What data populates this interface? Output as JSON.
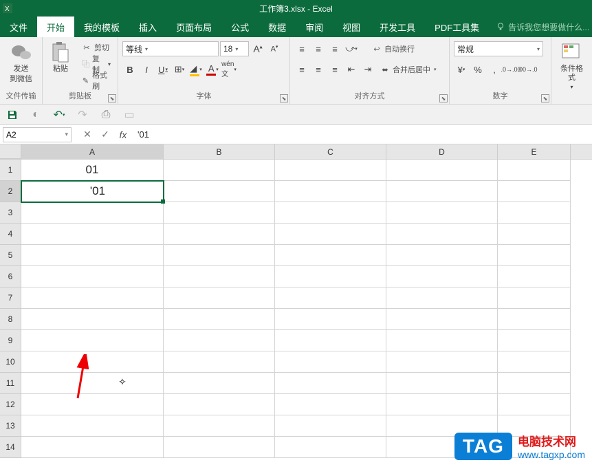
{
  "title": "工作簿3.xlsx - Excel",
  "menu": {
    "file": "文件",
    "home": "开始",
    "templates": "我的模板",
    "insert": "插入",
    "layout": "页面布局",
    "formulas": "公式",
    "data": "数据",
    "review": "审阅",
    "view": "视图",
    "dev": "开发工具",
    "pdf": "PDF工具集",
    "tellme": "告诉我您想要做什么..."
  },
  "ribbon": {
    "wechat": {
      "send": "发送",
      "to": "到微信",
      "group": "文件传输"
    },
    "clipboard": {
      "paste": "粘贴",
      "cut": "剪切",
      "copy": "复制",
      "format_painter": "格式刷",
      "group": "剪贴板"
    },
    "font": {
      "name": "等线",
      "size": "18",
      "bold": "B",
      "italic": "I",
      "underline": "U",
      "group": "字体"
    },
    "align": {
      "wrap": "自动换行",
      "merge": "合并后居中",
      "group": "对齐方式"
    },
    "number": {
      "format": "常规",
      "group": "数字"
    },
    "styles": {
      "cond": "条件格式",
      "group": ""
    }
  },
  "formula_bar": {
    "name_box": "A2",
    "formula": "'01"
  },
  "columns": [
    "A",
    "B",
    "C",
    "D",
    "E"
  ],
  "rows": [
    "1",
    "2",
    "3",
    "4",
    "5",
    "6",
    "7",
    "8",
    "9",
    "10",
    "11",
    "12",
    "13",
    "14"
  ],
  "cells": {
    "A1": "01",
    "A2_edit": "'01"
  },
  "watermark": {
    "tag": "TAG",
    "line1": "电脑技术网",
    "line2": "www.tagxp.com"
  }
}
